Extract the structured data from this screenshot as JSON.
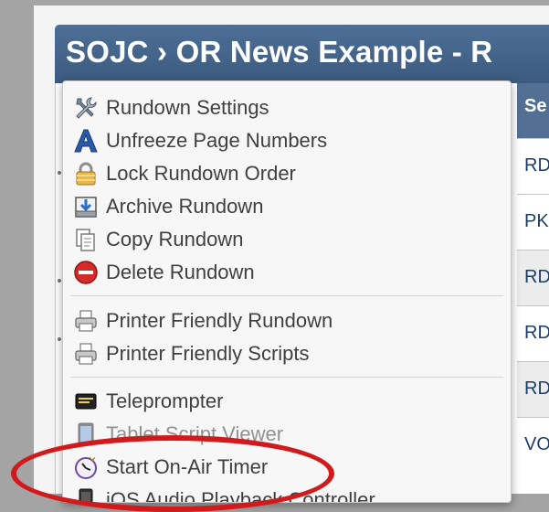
{
  "window": {
    "title": "SOJC › OR News Example - R"
  },
  "table": {
    "header": "Se",
    "rows": [
      "RD",
      "PK",
      "RD",
      "RD",
      "RD",
      "VO"
    ]
  },
  "menu": {
    "items": [
      {
        "label": "Rundown Settings",
        "icon": "tools-icon"
      },
      {
        "label": "Unfreeze Page Numbers",
        "icon": "font-a-icon"
      },
      {
        "label": "Lock Rundown Order",
        "icon": "padlock-icon"
      },
      {
        "label": "Archive Rundown",
        "icon": "archive-box-icon"
      },
      {
        "label": "Copy Rundown",
        "icon": "copy-pages-icon"
      },
      {
        "label": "Delete Rundown",
        "icon": "delete-circle-icon"
      },
      {
        "label": "Printer Friendly Rundown",
        "icon": "printer-icon"
      },
      {
        "label": "Printer Friendly Scripts",
        "icon": "printer-icon"
      },
      {
        "label": "Teleprompter",
        "icon": "teleprompter-icon"
      },
      {
        "label": "Tablet Script Viewer",
        "icon": "tablet-icon"
      },
      {
        "label": "Start On-Air Timer",
        "icon": "stopwatch-icon"
      },
      {
        "label": "iOS Audio Playback Controller",
        "icon": "phone-icon"
      }
    ]
  },
  "colors": {
    "title_bar": "#45658c",
    "header": "#536f94",
    "highlight": "#d01a1c",
    "delete_red": "#d42a2a"
  }
}
